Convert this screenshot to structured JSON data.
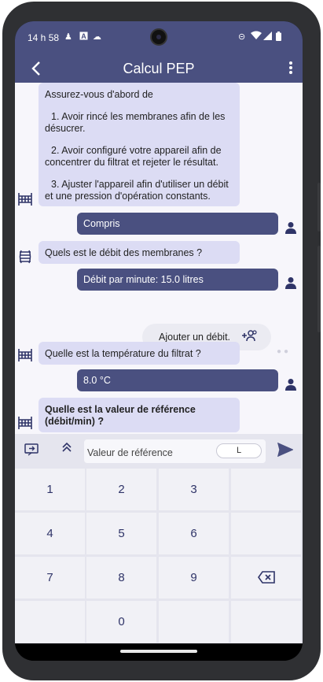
{
  "status": {
    "time": "14 h 58",
    "icons": [
      "person-icon",
      "a-badge-icon",
      "cloud-icon",
      "dnd-icon",
      "wifi-icon",
      "signal-icon",
      "battery-icon"
    ]
  },
  "appbar": {
    "title": "Calcul PEP",
    "back_icon": "back-arrow-icon",
    "menu_icon": "more-vert-icon"
  },
  "chat": {
    "intro_heading": "Assurez-vous d'abord de",
    "intro_step1": "1. Avoir rincé les membranes afin de les désucrer.",
    "intro_step2": "2. Avoir configuré votre appareil afin de concentrer du filtrat et rejeter le résultat.",
    "intro_step3": "3. Ajuster l'appareil afin d'utiliser un débit et une pression d'opération constants.",
    "reply_understood": "Compris",
    "question_flow": "Quels est le débit des membranes ?",
    "answer_flow": "Débit par minute: 15.0 litres",
    "add_flow_label": "Ajouter un débit.",
    "question_temp": "Quelle est la température du filtrat ?",
    "answer_temp": "8.0 °C",
    "question_reference": "Quelle est la valeur de référence (débit/min) ?"
  },
  "input": {
    "placeholder": "Valeur de référence",
    "unit": "L"
  },
  "keypad": {
    "keys": [
      "1",
      "2",
      "3",
      "4",
      "5",
      "6",
      "7",
      "8",
      "9",
      "0"
    ]
  },
  "colors": {
    "primary": "#4a5080",
    "bot_bubble": "#dcdcf4",
    "background": "#f7f6fb",
    "keypad": "#e5e5ee"
  }
}
